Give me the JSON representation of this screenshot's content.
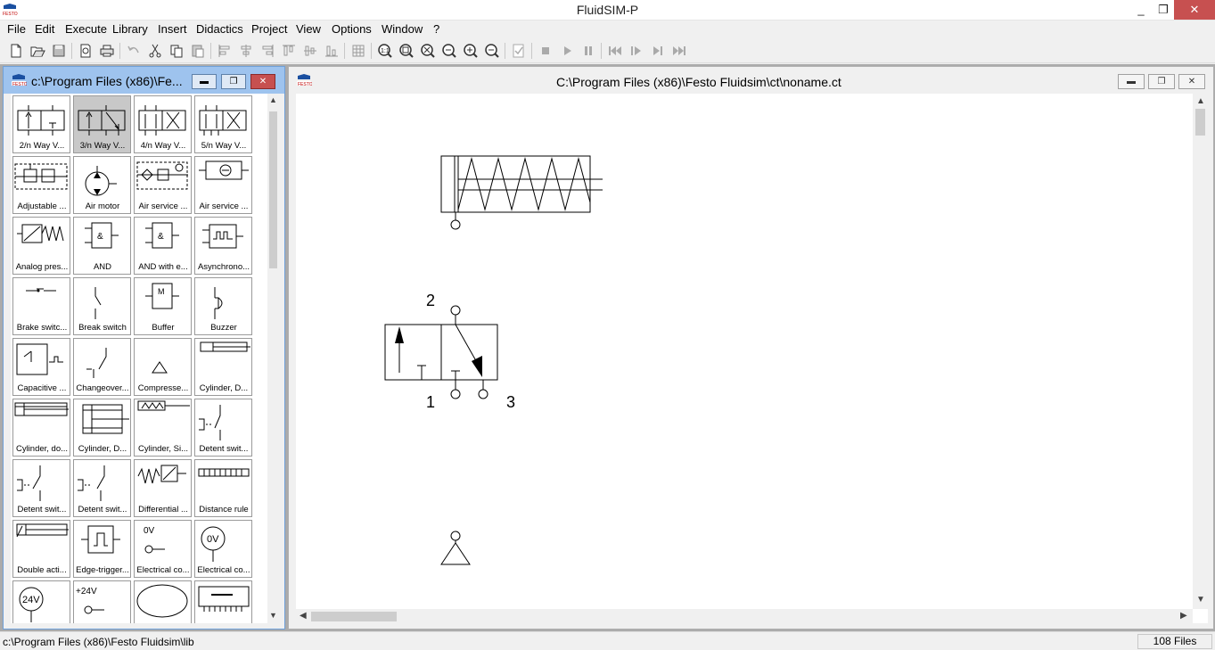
{
  "app": {
    "title": "FluidSIM-P",
    "logo_text": "FESTO",
    "controls": {
      "minimize": "_",
      "maximize": "❐",
      "close": "✕"
    }
  },
  "menu": [
    "File",
    "Edit",
    "Execute",
    "Library",
    "Insert",
    "Didactics",
    "Project",
    "View",
    "Options",
    "Window",
    "?"
  ],
  "toolbar": {
    "icons": [
      "new-file-icon",
      "open-file-icon",
      "save-icon",
      "separator",
      "print-preview-icon",
      "print-icon",
      "separator",
      "undo-icon",
      "cut-icon",
      "copy-icon",
      "paste-icon",
      "separator",
      "align-left-icon",
      "align-center-icon",
      "align-top-icon",
      "align-middle-icon",
      "separator",
      "grid-icon",
      "separator",
      "zoom-fit-icon",
      "zoom-window-icon",
      "zoom-all-icon",
      "zoom-previous-icon",
      "zoom-in-icon",
      "zoom-out-icon",
      "separator",
      "check-icon",
      "separator",
      "stop-icon",
      "play-icon",
      "pause-icon",
      "separator",
      "rewind-icon",
      "step-icon",
      "step-to-end-icon",
      "fast-forward-icon"
    ]
  },
  "library_window": {
    "title": "c:\\Program Files (x86)\\Fe...",
    "items": [
      {
        "label": "2/n Way V...",
        "icon": "valve-2-way-icon",
        "selected": false
      },
      {
        "label": "3/n Way V...",
        "icon": "valve-3-way-icon",
        "selected": true
      },
      {
        "label": "4/n Way V...",
        "icon": "valve-4-way-icon",
        "selected": false
      },
      {
        "label": "5/n Way V...",
        "icon": "valve-5-way-icon",
        "selected": false
      },
      {
        "label": "Adjustable ...",
        "icon": "adjustable-valve-icon",
        "selected": false
      },
      {
        "label": "Air motor",
        "icon": "air-motor-icon",
        "selected": false
      },
      {
        "label": "Air service ...",
        "icon": "air-service-unit-icon",
        "selected": false
      },
      {
        "label": "Air service ...",
        "icon": "air-service-unit-simplified-icon",
        "selected": false
      },
      {
        "label": "Analog pres...",
        "icon": "analog-pressure-sensor-icon",
        "selected": false
      },
      {
        "label": "AND",
        "icon": "and-gate-icon",
        "selected": false
      },
      {
        "label": "AND with e...",
        "icon": "and-edge-gate-icon",
        "selected": false
      },
      {
        "label": "Asynchrono...",
        "icon": "asynchronous-icon",
        "selected": false
      },
      {
        "label": "Brake switc...",
        "icon": "brake-switch-icon",
        "selected": false
      },
      {
        "label": "Break switch",
        "icon": "break-switch-icon",
        "selected": false
      },
      {
        "label": "Buffer",
        "icon": "buffer-icon",
        "selected": false
      },
      {
        "label": "Buzzer",
        "icon": "buzzer-icon",
        "selected": false
      },
      {
        "label": "Capacitive ...",
        "icon": "capacitive-sensor-icon",
        "selected": false
      },
      {
        "label": "Changeover...",
        "icon": "changeover-switch-icon",
        "selected": false
      },
      {
        "label": "Compresse...",
        "icon": "compressed-air-supply-icon",
        "selected": false
      },
      {
        "label": "Cylinder, D...",
        "icon": "cylinder-double-icon",
        "selected": false
      },
      {
        "label": "Cylinder, do...",
        "icon": "cylinder-double-acting-icon",
        "selected": false
      },
      {
        "label": "Cylinder, D...",
        "icon": "cylinder-double-rod-icon",
        "selected": false
      },
      {
        "label": "Cylinder, Si...",
        "icon": "cylinder-single-acting-icon",
        "selected": false
      },
      {
        "label": "Detent swit...",
        "icon": "detent-switch-icon",
        "selected": false
      },
      {
        "label": "Detent swit...",
        "icon": "detent-switch-nc-icon",
        "selected": false
      },
      {
        "label": "Detent swit...",
        "icon": "detent-switch-co-icon",
        "selected": false
      },
      {
        "label": "Differential ...",
        "icon": "differential-pressure-icon",
        "selected": false
      },
      {
        "label": "Distance rule",
        "icon": "distance-rule-icon",
        "selected": false
      },
      {
        "label": "Double acti...",
        "icon": "double-acting-cylinder-icon",
        "selected": false
      },
      {
        "label": "Edge-trigger...",
        "icon": "edge-trigger-icon",
        "selected": false
      },
      {
        "label": "Electrical co...",
        "icon": "electrical-connection-0v-icon",
        "selected": false
      },
      {
        "label": "Electrical co...",
        "icon": "electrical-connection-0v-circle-icon",
        "selected": false
      },
      {
        "label": "",
        "icon": "voltage-24v-circle-icon",
        "selected": false
      },
      {
        "label": "",
        "icon": "voltage-24v-icon",
        "selected": false
      },
      {
        "label": "",
        "icon": "ellipse-icon",
        "selected": false
      },
      {
        "label": "",
        "icon": "terminal-strip-icon",
        "selected": false
      }
    ],
    "tile_texts": {
      "v0": "0V",
      "v0c": "0V",
      "v24c": "24V",
      "v24": "+24V",
      "motor": "M",
      "and": "&"
    }
  },
  "circuit_window": {
    "title": "C:\\Program Files (x86)\\Festo Fluidsim\\ct\\noname.ct",
    "ports": {
      "p1": "1",
      "p2": "2",
      "p3": "3"
    }
  },
  "status": {
    "path": "c:\\Program Files (x86)\\Festo Fluidsim\\lib",
    "file_count": "108 Files"
  },
  "colors": {
    "active_title": "#9ec3ee",
    "close_red": "#c75050",
    "selected_tile": "#c8c8c8"
  }
}
